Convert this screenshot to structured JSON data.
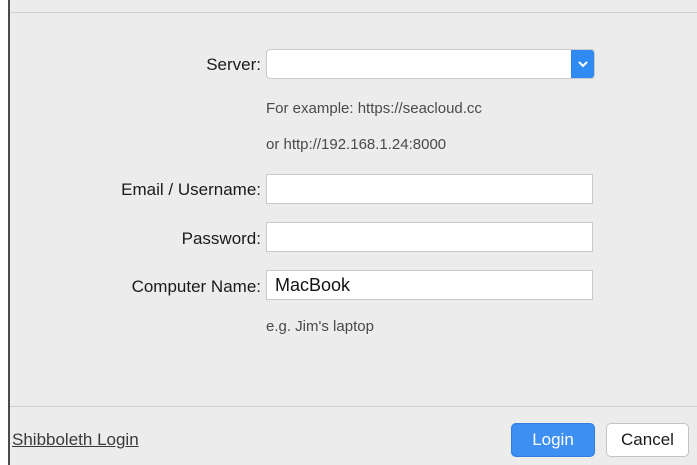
{
  "form": {
    "server_label": "Server:",
    "server_value": "",
    "server_hint_1": "For example: https://seacloud.cc",
    "server_hint_2": "or http://192.168.1.24:8000",
    "email_label": "Email / Username:",
    "email_value": "",
    "password_label": "Password:",
    "password_value": "",
    "computer_label": "Computer Name:",
    "computer_value": "MacBook",
    "computer_hint": "e.g. Jim's laptop"
  },
  "footer": {
    "shibboleth_link": "Shibboleth Login",
    "login_button": "Login",
    "cancel_button": "Cancel"
  },
  "colors": {
    "accent": "#3d8ff2",
    "background": "#ececec"
  },
  "icons": {
    "combo_arrow": "chevron-down-icon"
  }
}
